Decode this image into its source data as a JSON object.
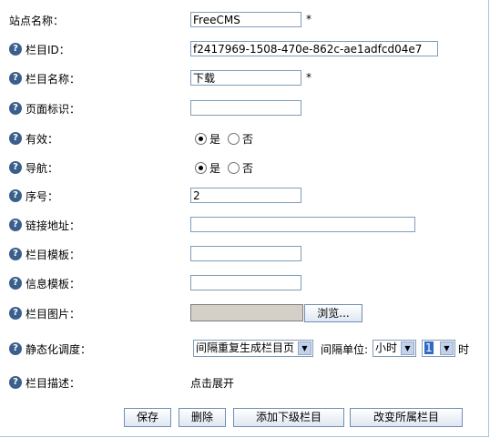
{
  "fields": {
    "site_name": {
      "label": "站点名称：",
      "value": "FreeCMS",
      "required": "*"
    },
    "channel_id": {
      "label": "栏目ID：",
      "value": "f2417969-1508-470e-862c-ae1adfcd04e7"
    },
    "channel_name": {
      "label": "栏目名称：",
      "value": "下载",
      "required": "*"
    },
    "page_mark": {
      "label": "页面标识：",
      "value": ""
    },
    "valid": {
      "label": "有效：",
      "options": [
        "是",
        "否"
      ],
      "selected": "是"
    },
    "navigation": {
      "label": "导航：",
      "options": [
        "是",
        "否"
      ],
      "selected": "是"
    },
    "order_num": {
      "label": "序号：",
      "value": "2"
    },
    "link_url": {
      "label": "链接地址：",
      "value": ""
    },
    "channel_template": {
      "label": "栏目模板：",
      "value": ""
    },
    "info_template": {
      "label": "信息模板：",
      "value": ""
    },
    "channel_image": {
      "label": "栏目图片：",
      "browse_label": "浏览..."
    },
    "static_schedule": {
      "label": "静态化调度：",
      "type_value": "间隔重复生成栏目页",
      "unit_label": "间隔单位:",
      "unit_value": "小时",
      "interval_value": "1",
      "suffix": "时"
    },
    "description": {
      "label": "栏目描述：",
      "link_text": "点击展开"
    }
  },
  "buttons": {
    "save": "保存",
    "delete": "删除",
    "add_child": "添加下级栏目",
    "change_parent": "改变所属栏目"
  },
  "icons": {
    "help": "?"
  },
  "colors": {
    "help_icon": "#3b5f8c",
    "border": "#7f9db9",
    "selected": "#316ac5"
  }
}
